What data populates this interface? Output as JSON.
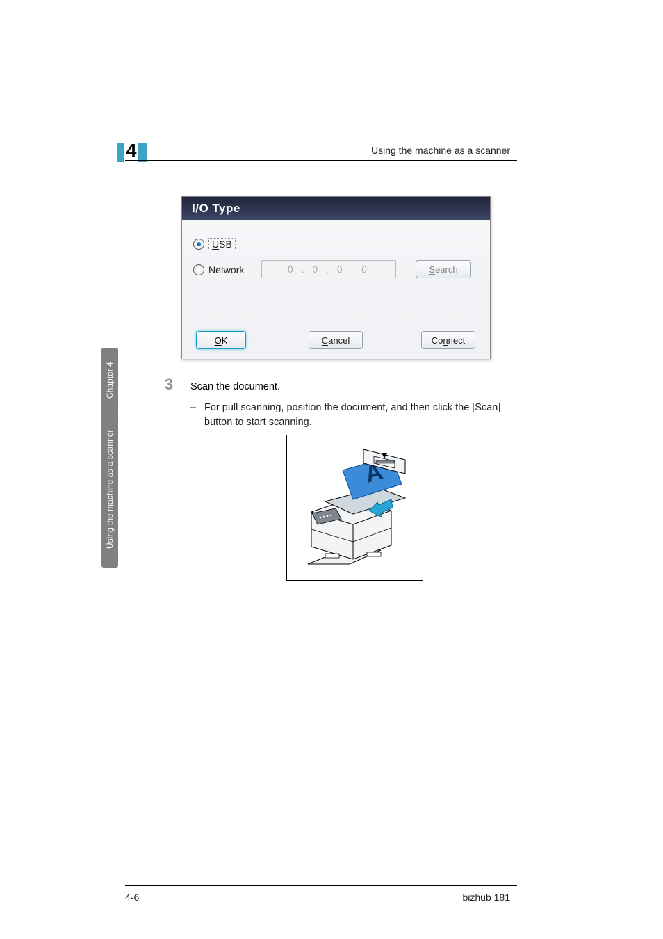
{
  "header": {
    "section_title": "Using the machine as a scanner",
    "chapter_number": "4"
  },
  "side_tabs": {
    "chapter": "Chapter 4",
    "section": "Using the machine as a scanner"
  },
  "dialog": {
    "title": "I/O Type",
    "usb_label": "USB",
    "usb_accel": "U",
    "network_label": "Network",
    "network_accel": "w",
    "ip_value": "0  .  0  .  0  .  0",
    "search_label": "Search",
    "search_accel": "S",
    "ok_label": "OK",
    "ok_accel": "O",
    "cancel_label": "Cancel",
    "cancel_accel": "C",
    "connect_label": "Connect",
    "connect_accel": "n"
  },
  "steps": {
    "s3_num": "3",
    "s3_text": "Scan the document.",
    "s3_bullet": "For pull scanning, position the document, and then click the [Scan] button to start scanning."
  },
  "footer": {
    "page": "4-6",
    "product": "bizhub 181"
  }
}
